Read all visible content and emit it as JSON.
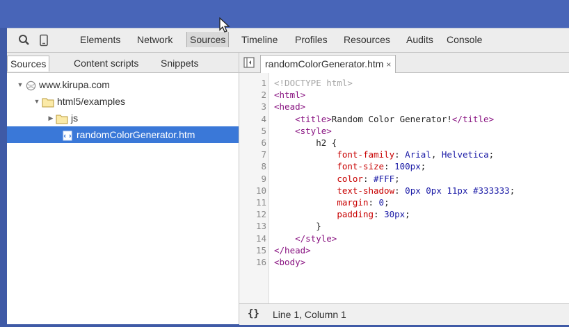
{
  "toolbar": {
    "tabs": [
      "Elements",
      "Network",
      "Sources",
      "Timeline",
      "Profiles",
      "Resources",
      "Audits",
      "Console"
    ],
    "selected": "Sources",
    "icons": [
      "search-icon",
      "device-mode-icon"
    ]
  },
  "navigator": {
    "tabs": [
      "Sources",
      "Content scripts",
      "Snippets"
    ],
    "tree": {
      "domain": "www.kirupa.com",
      "folder": "html5/examples",
      "subfolder": "js",
      "file": "randomColorGenerator.htm"
    }
  },
  "editor": {
    "tab_label": "randomColorGenerator.htm",
    "close_glyph": "×",
    "lines": [
      {
        "n": "1",
        "parts": [
          [
            "t-doctype",
            "<!DOCTYPE html>"
          ]
        ]
      },
      {
        "n": "2",
        "parts": [
          [
            "t-tag",
            "<html>"
          ]
        ]
      },
      {
        "n": "3",
        "parts": [
          [
            "t-tag",
            "<head>"
          ]
        ]
      },
      {
        "n": "4",
        "parts": [
          [
            "t-text",
            "    "
          ],
          [
            "t-tag",
            "<title>"
          ],
          [
            "t-text",
            "Random Color Generator!"
          ],
          [
            "t-tag",
            "</title>"
          ]
        ]
      },
      {
        "n": "5",
        "parts": [
          [
            "t-text",
            "    "
          ],
          [
            "t-tag",
            "<style>"
          ]
        ]
      },
      {
        "n": "6",
        "parts": [
          [
            "t-text",
            "        h2 {"
          ]
        ]
      },
      {
        "n": "7",
        "parts": [
          [
            "t-text",
            "            "
          ],
          [
            "t-prop",
            "font-family"
          ],
          [
            "t-punct",
            ": "
          ],
          [
            "t-val",
            "Arial"
          ],
          [
            "t-punct",
            ", "
          ],
          [
            "t-val",
            "Helvetica"
          ],
          [
            "t-punct",
            ";"
          ]
        ]
      },
      {
        "n": "8",
        "parts": [
          [
            "t-text",
            "            "
          ],
          [
            "t-prop",
            "font-size"
          ],
          [
            "t-punct",
            ": "
          ],
          [
            "t-val",
            "100px"
          ],
          [
            "t-punct",
            ";"
          ]
        ]
      },
      {
        "n": "9",
        "parts": [
          [
            "t-text",
            "            "
          ],
          [
            "t-prop",
            "color"
          ],
          [
            "t-punct",
            ": "
          ],
          [
            "t-val",
            "#FFF"
          ],
          [
            "t-punct",
            ";"
          ]
        ]
      },
      {
        "n": "10",
        "parts": [
          [
            "t-text",
            "            "
          ],
          [
            "t-prop",
            "text-shadow"
          ],
          [
            "t-punct",
            ": "
          ],
          [
            "t-val",
            "0px 0px 11px #333333"
          ],
          [
            "t-punct",
            ";"
          ]
        ]
      },
      {
        "n": "11",
        "parts": [
          [
            "t-text",
            "            "
          ],
          [
            "t-prop",
            "margin"
          ],
          [
            "t-punct",
            ": "
          ],
          [
            "t-val",
            "0"
          ],
          [
            "t-punct",
            ";"
          ]
        ]
      },
      {
        "n": "12",
        "parts": [
          [
            "t-text",
            "            "
          ],
          [
            "t-prop",
            "padding"
          ],
          [
            "t-punct",
            ": "
          ],
          [
            "t-val",
            "30px"
          ],
          [
            "t-punct",
            ";"
          ]
        ]
      },
      {
        "n": "13",
        "parts": [
          [
            "t-text",
            "        }"
          ]
        ]
      },
      {
        "n": "14",
        "parts": [
          [
            "t-text",
            "    "
          ],
          [
            "t-tag",
            "</style>"
          ]
        ]
      },
      {
        "n": "15",
        "parts": [
          [
            "t-tag",
            "</head>"
          ]
        ]
      },
      {
        "n": "16",
        "parts": [
          [
            "t-tag",
            "<body>"
          ]
        ]
      }
    ]
  },
  "status": {
    "pretty_print_glyph": "{}",
    "position": "Line 1, Column 1"
  },
  "colors": {
    "selection": "#3a78d8",
    "frame": "#4865b8"
  }
}
